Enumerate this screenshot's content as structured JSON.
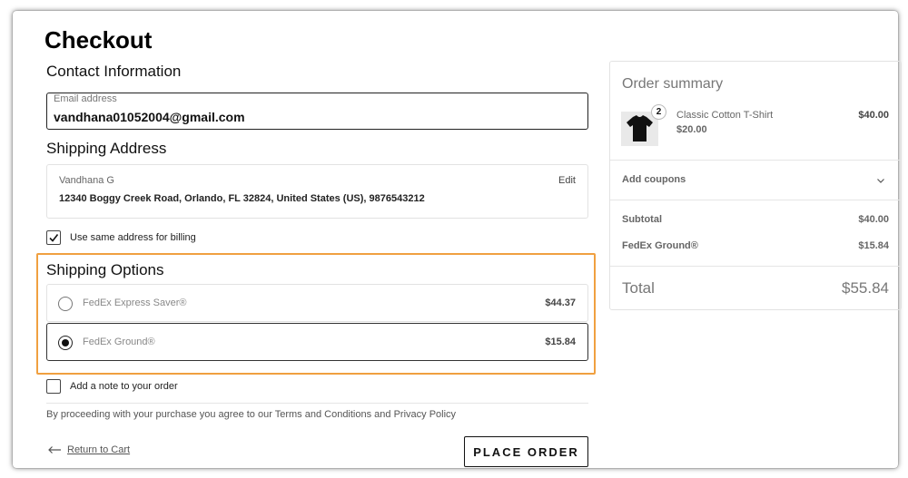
{
  "page": {
    "title": "Checkout"
  },
  "contact": {
    "heading": "Contact Information",
    "email_label": "Email address",
    "email_value": "vandhana01052004@gmail.com"
  },
  "shipping_address": {
    "heading": "Shipping Address",
    "name": "Vandhana G",
    "edit_label": "Edit",
    "address_line": "12340 Boggy Creek Road, Orlando, FL 32824, United States (US), 9876543212"
  },
  "billing": {
    "same_address_label": "Use same address for billing",
    "checked": true
  },
  "shipping_options": {
    "heading": "Shipping Options",
    "options": [
      {
        "label": "FedEx Express Saver®",
        "price": "$44.37",
        "selected": false
      },
      {
        "label": "FedEx Ground®",
        "price": "$15.84",
        "selected": true
      }
    ]
  },
  "note": {
    "label": "Add a note to your order",
    "checked": false
  },
  "terms": {
    "text": "By proceeding with your purchase you agree to our Terms and Conditions and Privacy Policy"
  },
  "footer": {
    "return_label": "Return to Cart",
    "place_order_label": "PLACE ORDER"
  },
  "summary": {
    "heading": "Order summary",
    "item": {
      "name": "Classic Cotton T-Shirt",
      "unit_price": "$20.00",
      "quantity": "2",
      "line_total": "$40.00"
    },
    "coupons_label": "Add coupons",
    "subtotal_label": "Subtotal",
    "subtotal_value": "$40.00",
    "shipping_label": "FedEx Ground®",
    "shipping_value": "$15.84",
    "total_label": "Total",
    "total_value": "$55.84"
  },
  "colors": {
    "highlight": "#f0a040",
    "text": "#111111",
    "muted": "#777777",
    "border": "#e2e2e2"
  },
  "icons": [
    "check-icon",
    "arrow-left-icon",
    "chevron-down-icon",
    "tshirt-icon"
  ]
}
